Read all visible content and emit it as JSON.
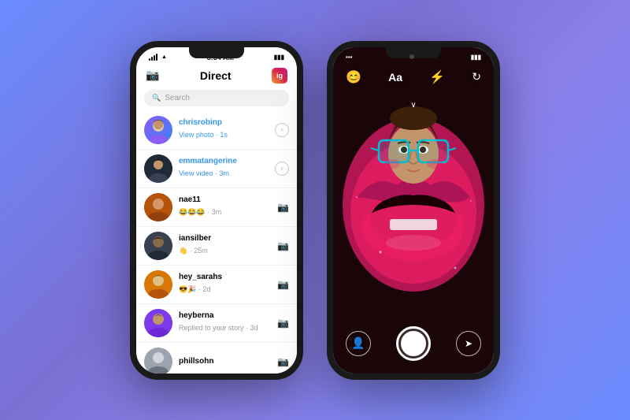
{
  "background": {
    "gradient_start": "#6b8cff",
    "gradient_end": "#8b7fe8"
  },
  "left_phone": {
    "status_bar": {
      "signal": "▌▌▌",
      "wifi": "WiFi",
      "time": "8:34 AM",
      "battery": "🔋"
    },
    "header": {
      "camera_label": "📷",
      "title": "Direct",
      "instagram_label": "ig"
    },
    "search": {
      "placeholder": "Search"
    },
    "conversations": [
      {
        "username": "chrisrobinp",
        "preview": "View photo · 1s",
        "action": "circle-arrow",
        "is_unread": true,
        "avatar_color": "#8b5cf6"
      },
      {
        "username": "emmatangerine",
        "preview": "View video · 3m",
        "action": "circle-arrow",
        "is_unread": true,
        "avatar_color": "#374151"
      },
      {
        "username": "nae11",
        "preview": "😂😂😂 · 3m",
        "action": "camera",
        "is_unread": false,
        "avatar_color": "#b45309"
      },
      {
        "username": "iansilber",
        "preview": "👋 · 25m",
        "action": "camera",
        "is_unread": false,
        "avatar_color": "#374151"
      },
      {
        "username": "hey_sarahs",
        "preview": "😎🎉 · 2d",
        "action": "camera",
        "is_unread": false,
        "avatar_color": "#d97706"
      },
      {
        "username": "heyberna",
        "preview": "Replied to your story · 3d",
        "action": "camera",
        "is_unread": false,
        "avatar_color": "#7c3aed"
      },
      {
        "username": "phillsohn",
        "preview": "",
        "action": "camera",
        "is_unread": false,
        "avatar_color": "#9ca3af"
      }
    ]
  },
  "right_phone": {
    "status_bar": {
      "dots": "•••",
      "time": "",
      "battery": ""
    },
    "top_bar_icons": {
      "icon1": "😊",
      "icon2": "Aa",
      "icon3": "⚡",
      "icon4": "↺"
    },
    "bottom_bar": {
      "profile_icon": "👤",
      "shutter": "●",
      "send_icon": "➤"
    },
    "camera_label": "📷"
  }
}
